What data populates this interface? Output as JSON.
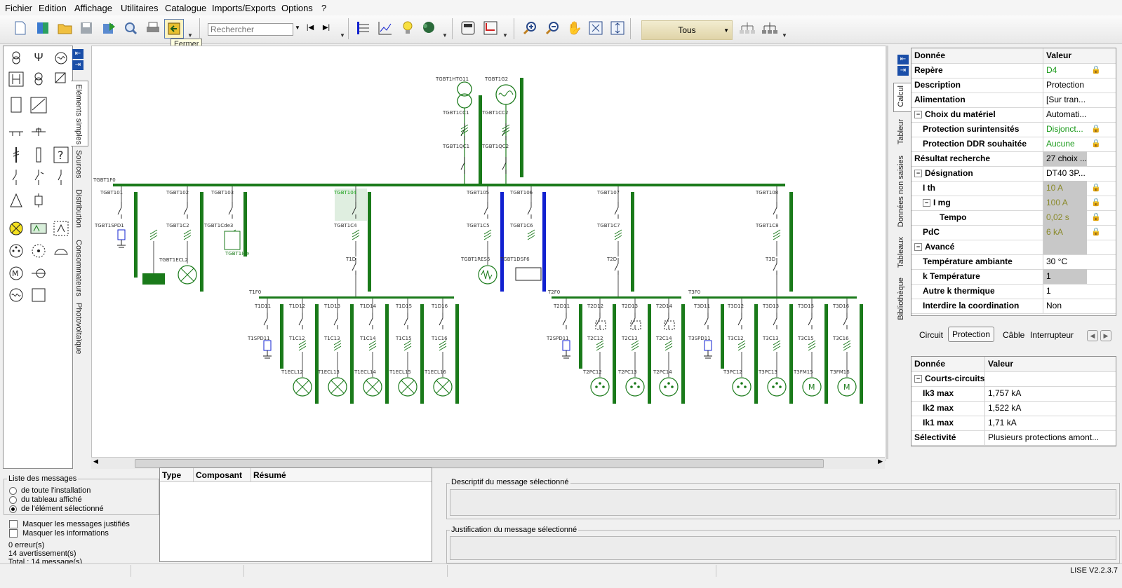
{
  "menu": [
    "Fichier",
    "Edition",
    "Affichage",
    "Utilitaires",
    "Catalogue",
    "Imports/Exports",
    "Options",
    "?"
  ],
  "toolbar": {
    "search_placeholder": "Rechercher",
    "tooltip": "Fermer",
    "filter_value": "Tous"
  },
  "left_tabs": [
    "Eléments simples",
    "Sources",
    "Distribution",
    "Consommateurs",
    "Photovoltaïque"
  ],
  "right_tabs": [
    "Calcul",
    "Tableur",
    "Données non saisies",
    "Tableaux",
    "Bibliothèque"
  ],
  "diagram_labels": {
    "top": [
      "TGBT1HTG11",
      "TGBT1G2",
      "TGBT1CC1",
      "TGBT1CC2",
      "TGBT1QC1",
      "TGBT1QC2"
    ],
    "main_bus": "TGBT1F0",
    "feeders": [
      "TGBT101",
      "TGBT102",
      "TGBT103",
      "TGBT104",
      "TGBT105",
      "TGBT106",
      "TGBT107",
      "TGBT108"
    ],
    "sub_labels": [
      "TGBT1SPD1",
      "TGBT1C2",
      "TGBT1Cde3",
      "TGBT1C4",
      "TGBT1C5",
      "TGBT1C6",
      "TGBT1C7",
      "TGBT1C8",
      "TGBT1ECL2",
      "TGBT1RES5",
      "TGBT1DSF6",
      "TGBT1Ide"
    ],
    "t_labels": [
      "T1D",
      "T2D",
      "T3D"
    ],
    "sub_buses": [
      "T1F0",
      "T2F0",
      "T3F0"
    ],
    "t1": [
      "T1D11",
      "T1D12",
      "T1D13",
      "T1D14",
      "T1D15",
      "T1D16"
    ],
    "t1c": [
      "T1SPD11",
      "T1C12",
      "T1C13",
      "T1C14",
      "T1C15",
      "T1C16"
    ],
    "t1e": [
      "T1ECL12",
      "T1ECL13",
      "T1ECL14",
      "T1ECL15",
      "T1ECL16"
    ],
    "t2": [
      "T2D11",
      "T2D12",
      "T2D13",
      "T2D14"
    ],
    "t2c": [
      "T2SPD11",
      "T2C12",
      "T2C13",
      "T2C14"
    ],
    "t2e": [
      "T2PC12",
      "T2PC13",
      "T2PC14"
    ],
    "t3": [
      "T3D11",
      "T3D12",
      "T3D13",
      "T3D15",
      "T3D16"
    ],
    "t3c": [
      "T3SPD11",
      "T3C12",
      "T3C13",
      "T3C15",
      "T3C16"
    ],
    "t3e": [
      "T3PC12",
      "T3PC13",
      "T3FM15",
      "T3FM16"
    ]
  },
  "prop_grid": {
    "header": {
      "col1": "Donnée",
      "col2": "Valeur"
    },
    "rows": [
      {
        "label": "Repère",
        "value": "D4",
        "lock": "green",
        "indent": 0,
        "value_color": "#1a9a1a"
      },
      {
        "label": "Description",
        "value": "Protection",
        "indent": 0
      },
      {
        "label": "Alimentation",
        "value": "[Sur tran...",
        "indent": 0
      },
      {
        "label": "Choix du matériel",
        "value": "Automati...",
        "indent": 0,
        "expander": "⊟"
      },
      {
        "label": "Protection surintensités",
        "value": "Disjonct...",
        "lock": "green",
        "indent": 1,
        "value_color": "#1a9a1a"
      },
      {
        "label": "Protection DDR souhaitée",
        "value": "Aucune",
        "lock": "green",
        "indent": 1,
        "value_color": "#1a9a1a"
      },
      {
        "label": "Résultat recherche",
        "value": "27 choix ...",
        "indent": 0,
        "shade": true
      },
      {
        "label": "Désignation",
        "value": "DT40 3P...",
        "indent": 0,
        "expander": "⊟"
      },
      {
        "label": "I th",
        "value": "10 A",
        "lock": "yellow",
        "indent": 1,
        "shade": true,
        "value_color": "#8a8a2a"
      },
      {
        "label": "I mg",
        "value": "100 A",
        "lock": "yellow",
        "indent": 1,
        "shade": true,
        "expander": "⊟",
        "value_color": "#8a8a2a"
      },
      {
        "label": "Tempo",
        "value": "0,02 s",
        "lock": "yellow",
        "indent": 3,
        "shade": true,
        "value_color": "#8a8a2a"
      },
      {
        "label": "PdC",
        "value": "6 kA",
        "lock": "yellow",
        "indent": 1,
        "shade": true,
        "value_color": "#8a8a2a"
      },
      {
        "label": "Avancé",
        "value": "",
        "indent": 0,
        "expander": "⊟",
        "shade": true
      },
      {
        "label": "Température ambiante",
        "value": "30 °C",
        "indent": 1
      },
      {
        "label": "k Température",
        "value": "1",
        "indent": 1,
        "shade": true
      },
      {
        "label": "Autre k thermique",
        "value": "1",
        "indent": 1
      },
      {
        "label": "Interdire la coordination",
        "value": "Non",
        "indent": 1
      }
    ]
  },
  "prop_tabs": [
    "Circuit",
    "Protection",
    "Câble",
    "Interrupteur"
  ],
  "result_grid": {
    "header": {
      "col1": "Donnée",
      "col2": "Valeur"
    },
    "rows": [
      {
        "label": "Courts-circuits",
        "value": "",
        "indent": 0,
        "expander": "⊟"
      },
      {
        "label": "Ik3 max",
        "value": "1,757 kA",
        "indent": 1
      },
      {
        "label": "Ik2 max",
        "value": "1,522 kA",
        "indent": 1
      },
      {
        "label": "Ik1 max",
        "value": "1,71 kA",
        "indent": 1
      },
      {
        "label": "Sélectivité",
        "value": "Plusieurs protections amont...",
        "indent": 0
      }
    ]
  },
  "messages": {
    "group_title": "Liste des messages",
    "options": [
      "de toute l'installation",
      "du tableau affiché",
      "de l'élément sélectionné"
    ],
    "selected_option": 2,
    "checks": [
      "Masquer les messages justifiés",
      "Masquer les informations"
    ],
    "counts": [
      "0 erreur(s)",
      "14 avertissement(s)",
      "Total : 14 message(s)"
    ],
    "table_cols": [
      "Type",
      "Composant",
      "Résumé"
    ],
    "desc_title": "Descriptif du message sélectionné",
    "just_title": "Justification du message sélectionné"
  },
  "status": {
    "version": "LISE V2.2.3.7"
  },
  "colors": {
    "bus_green": "#1a7a1a",
    "bus_blue": "#1020d0",
    "label_color": "#333333",
    "highlight": "#dfeee0"
  }
}
